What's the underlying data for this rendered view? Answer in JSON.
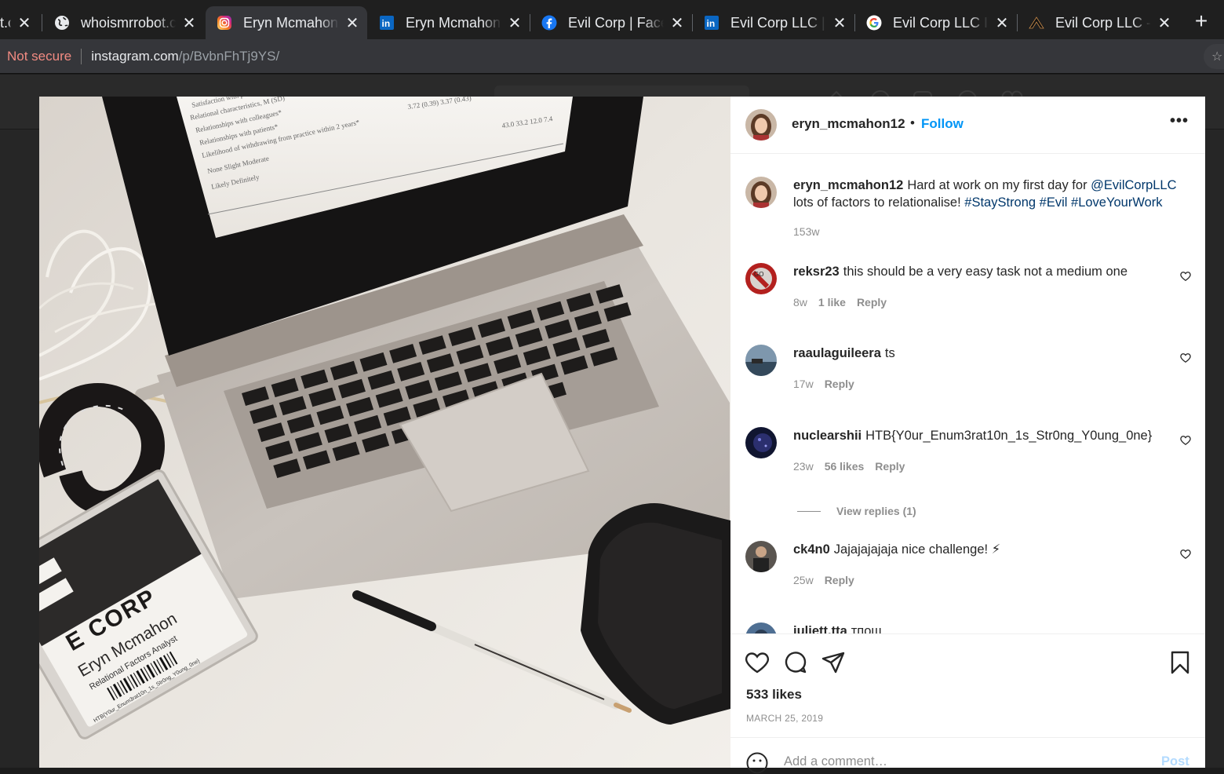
{
  "browser": {
    "tabs": [
      {
        "label": "t.c",
        "favicon": "globe-icon",
        "active": false
      },
      {
        "label": "whoismrrobot.c",
        "favicon": "globe-icon",
        "active": false
      },
      {
        "label": "Eryn Mcmahon",
        "favicon": "instagram-icon",
        "active": true
      },
      {
        "label": "Eryn Mcmahon",
        "favicon": "linkedin-icon",
        "active": false
      },
      {
        "label": "Evil Corp | Facel",
        "favicon": "facebook-icon",
        "active": false
      },
      {
        "label": "Evil Corp LLC | L",
        "favicon": "linkedin-icon",
        "active": false
      },
      {
        "label": "Evil Corp LLC IT",
        "favicon": "google-icon",
        "active": false
      },
      {
        "label": "Evil Corp LLC -",
        "favicon": "evilcorp-icon",
        "active": false
      }
    ],
    "security_label": "Not secure",
    "url_host": "instagram.com",
    "url_path": "/p/BvbnFhTj9YS/"
  },
  "post": {
    "author": "eryn_mcmahon12",
    "follow_label": "Follow",
    "separator": "•",
    "more_label": "•••",
    "caption": {
      "user": "eryn_mcmahon12",
      "text_before": "Hard at work on my first day for ",
      "mention": "@EvilCorpLLC",
      "text_mid": " lots of factors to relationalise! ",
      "hashtags": "#StayStrong #Evil #LoveYourWork",
      "time": "153w"
    },
    "comments": [
      {
        "user": "reksr23",
        "text": "this should be a very easy task not a medium one",
        "time": "8w",
        "likes": "1 like",
        "reply": "Reply"
      },
      {
        "user": "raaulaguileera",
        "text": "ts",
        "time": "17w",
        "likes": "",
        "reply": "Reply"
      },
      {
        "user": "nuclearshii",
        "text": "HTB{Y0ur_Enum3rat10n_1s_Str0ng_Y0ung_0ne}",
        "time": "23w",
        "likes": "56 likes",
        "reply": "Reply",
        "view_replies": "View replies (1)"
      },
      {
        "user": "ck4n0",
        "text": "Jajajajajaja nice challenge! ⚡",
        "time": "25w",
        "likes": "",
        "reply": "Reply"
      },
      {
        "user": "juliett.tta",
        "text": "тпощ"
      }
    ],
    "likes_count": "533 likes",
    "date": "MARCH 25, 2019",
    "comment_placeholder": "Add a comment…",
    "post_button": "Post"
  },
  "photo": {
    "badge_corp": "E CORP",
    "badge_name": "Eryn Mcmahon",
    "badge_title": "Relational Factors Analyst",
    "badge_code": "HTB{Y0ur_Enum3rat10n_1s_Str0ng_Y0ung_0ne}"
  },
  "colors": {
    "link_blue": "#0095f6",
    "mention_blue": "#00376b",
    "not_secure": "#f28b82",
    "tab_active": "#35363a"
  }
}
